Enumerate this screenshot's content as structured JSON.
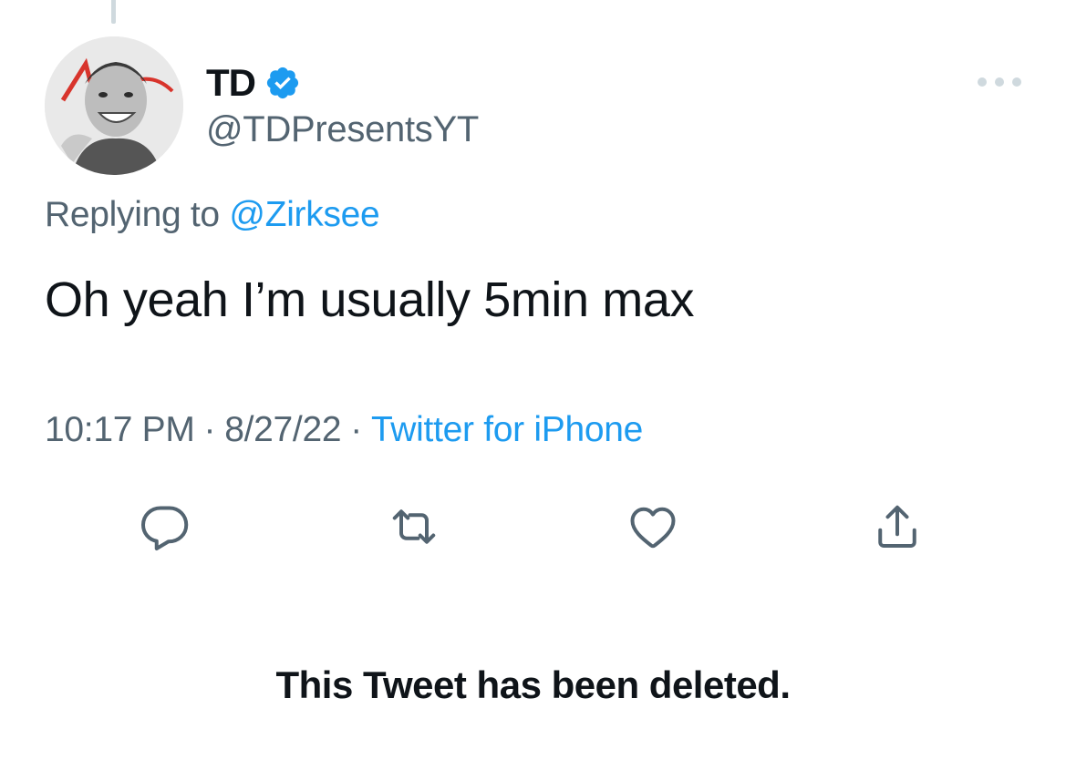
{
  "author": {
    "display_name": "TD",
    "handle": "@TDPresentsYT",
    "verified": true,
    "avatar_icon": "profile-photo"
  },
  "reply": {
    "prefix": "Replying to",
    "mention": "@Zirksee"
  },
  "tweet": {
    "text": "Oh yeah I’m usually 5min max"
  },
  "meta": {
    "time": "10:17 PM",
    "separator": "·",
    "date": "8/27/22",
    "source": "Twitter for iPhone"
  },
  "actions": [
    {
      "name": "reply",
      "icon": "reply-bubble-icon"
    },
    {
      "name": "retweet",
      "icon": "retweet-icon"
    },
    {
      "name": "like",
      "icon": "heart-icon"
    },
    {
      "name": "share",
      "icon": "share-icon"
    }
  ],
  "status": {
    "deleted_message": "This Tweet has been deleted."
  },
  "colors": {
    "text_primary": "#0f1419",
    "text_secondary": "#536471",
    "accent": "#1d9bf0",
    "divider": "#cfd9de"
  }
}
